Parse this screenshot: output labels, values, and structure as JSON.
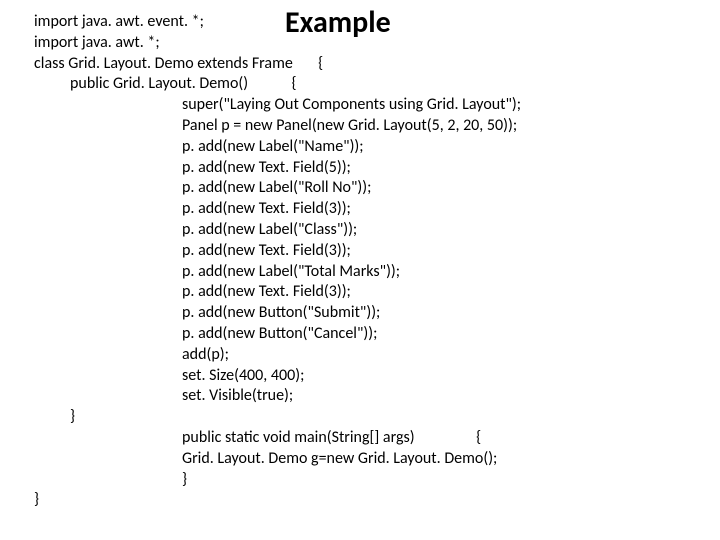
{
  "title": "Example",
  "code": {
    "line1": "import java. awt. event. *;",
    "line2": "import java. awt. *;",
    "line3": "class Grid. Layout. Demo extends Frame       {",
    "line4": "public Grid. Layout. Demo()            {",
    "line5": "super(\"Laying Out Components using Grid. Layout\");",
    "line6": "Panel p = new Panel(new Grid. Layout(5, 2, 20, 50));",
    "line7": "p. add(new Label(\"Name\"));",
    "line8": "p. add(new Text. Field(5));",
    "line9": "p. add(new Label(\"Roll No\"));",
    "line10": "p. add(new Text. Field(3));",
    "line11": "p. add(new Label(\"Class\"));",
    "line12": "p. add(new Text. Field(3));",
    "line13": "p. add(new Label(\"Total Marks\"));",
    "line14": "p. add(new Text. Field(3));",
    "line15": "p. add(new Button(\"Submit\"));",
    "line16": "p. add(new Button(\"Cancel\"));",
    "line17": "add(p);",
    "line18": "set. Size(400, 400);",
    "line19": "set. Visible(true);",
    "line20": "}",
    "line21": "public static void main(String[] args)                 {",
    "line22": "Grid. Layout. Demo g=new Grid. Layout. Demo();",
    "line23": "}",
    "line24": "}"
  }
}
